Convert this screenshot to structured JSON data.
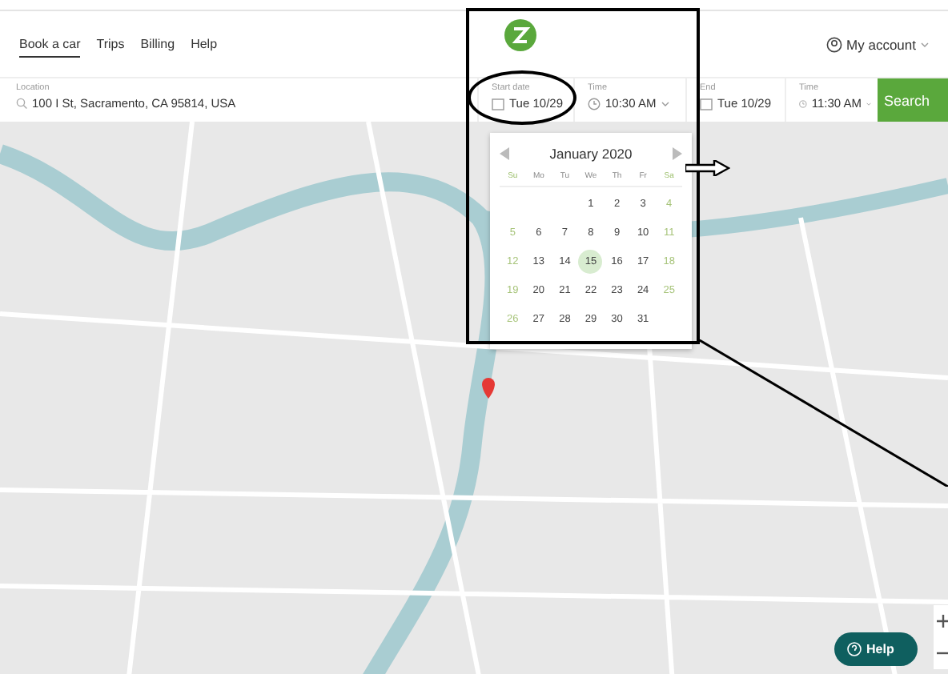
{
  "nav": {
    "tabs": [
      {
        "label": "Book a car",
        "selected": true
      },
      {
        "label": "Trips",
        "selected": false
      },
      {
        "label": "Billing",
        "selected": false
      },
      {
        "label": "Help",
        "selected": false
      }
    ],
    "account": "My account"
  },
  "search_bar": {
    "location": {
      "label": "Location",
      "value": "100 I St, Sacramento, CA 95814, USA"
    },
    "fields": [
      {
        "kind": "date",
        "label": "Start date",
        "value": "Tue 10/29"
      },
      {
        "kind": "time",
        "label": "Time",
        "value": "10:30 AM"
      },
      {
        "kind": "date",
        "label": "End",
        "value": "Tue 10/29"
      },
      {
        "kind": "time",
        "label": "Time",
        "value": "11:30 AM"
      }
    ],
    "button": "Search"
  },
  "calendar": {
    "month": "January 2020",
    "weekdays": [
      {
        "label": "Su",
        "weekend": true
      },
      {
        "label": "Mo",
        "weekend": false
      },
      {
        "label": "Tu",
        "weekend": false
      },
      {
        "label": "We",
        "weekend": false
      },
      {
        "label": "Th",
        "weekend": false
      },
      {
        "label": "Fr",
        "weekend": false
      },
      {
        "label": "Sa",
        "weekend": true
      }
    ],
    "days": [
      {
        "label": "1",
        "weekend": false,
        "selected": false
      },
      {
        "label": "2",
        "weekend": false,
        "selected": false
      },
      {
        "label": "3",
        "weekend": false,
        "selected": false
      },
      {
        "label": "4",
        "weekend": true,
        "selected": false
      },
      {
        "label": "5",
        "weekend": true,
        "selected": false
      },
      {
        "label": "6",
        "weekend": false,
        "selected": false
      },
      {
        "label": "7",
        "weekend": false,
        "selected": false
      },
      {
        "label": "8",
        "weekend": false,
        "selected": false
      },
      {
        "label": "9",
        "weekend": false,
        "selected": false
      },
      {
        "label": "10",
        "weekend": false,
        "selected": false
      },
      {
        "label": "11",
        "weekend": true,
        "selected": false
      },
      {
        "label": "12",
        "weekend": true,
        "selected": false
      },
      {
        "label": "13",
        "weekend": false,
        "selected": false
      },
      {
        "label": "14",
        "weekend": false,
        "selected": false
      },
      {
        "label": "15",
        "weekend": false,
        "selected": true
      },
      {
        "label": "16",
        "weekend": false,
        "selected": false
      },
      {
        "label": "17",
        "weekend": false,
        "selected": false
      },
      {
        "label": "18",
        "weekend": true,
        "selected": false
      },
      {
        "label": "19",
        "weekend": true,
        "selected": false
      },
      {
        "label": "20",
        "weekend": false,
        "selected": false
      },
      {
        "label": "21",
        "weekend": false,
        "selected": false
      },
      {
        "label": "22",
        "weekend": false,
        "selected": false
      },
      {
        "label": "23",
        "weekend": false,
        "selected": false
      },
      {
        "label": "24",
        "weekend": false,
        "selected": false
      },
      {
        "label": "25",
        "weekend": true,
        "selected": false
      },
      {
        "label": "26",
        "weekend": true,
        "selected": false
      },
      {
        "label": "27",
        "weekend": false,
        "selected": false
      },
      {
        "label": "28",
        "weekend": false,
        "selected": false
      },
      {
        "label": "29",
        "weekend": false,
        "selected": false
      },
      {
        "label": "30",
        "weekend": false,
        "selected": false
      },
      {
        "label": "31",
        "weekend": false,
        "selected": false
      }
    ]
  },
  "help_button": "Help"
}
